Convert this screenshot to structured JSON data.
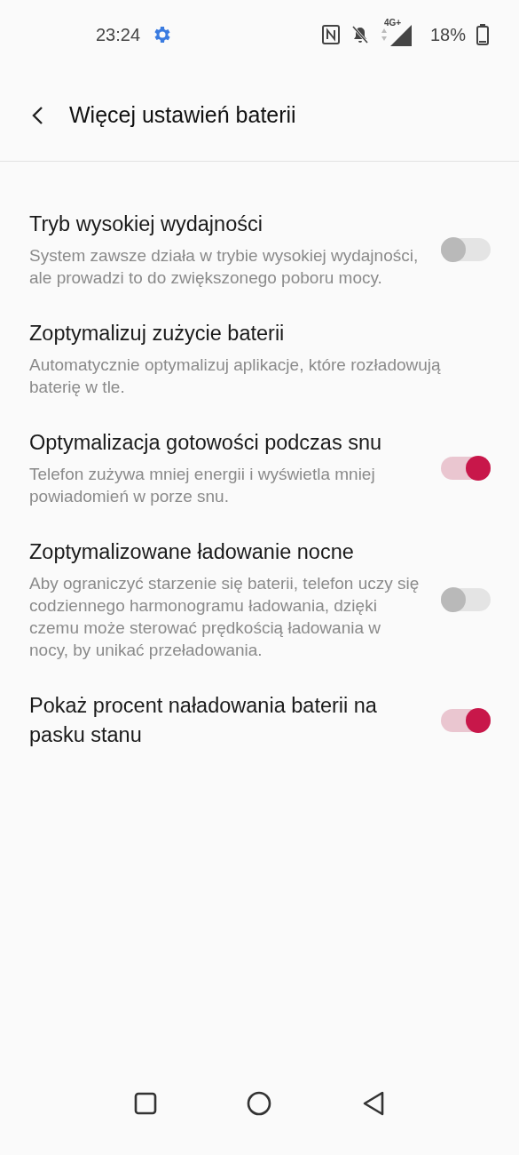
{
  "status_bar": {
    "time": "23:24",
    "network_type": "4G+",
    "battery": "18%"
  },
  "header": {
    "title": "Więcej ustawień baterii"
  },
  "settings": [
    {
      "title": "Tryb wysokiej wydajności",
      "description": "System zawsze działa w trybie wysokiej wydajności, ale prowadzi to do zwiększonego poboru mocy.",
      "kind": "toggle",
      "on": false
    },
    {
      "title": "Zoptymalizuj zużycie baterii",
      "description": "Automatycznie optymalizuj aplikacje, które rozładowują baterię w tle.",
      "kind": "link"
    },
    {
      "title": "Optymalizacja gotowości podczas snu",
      "description": "Telefon zużywa mniej energii i wyświetla mniej powiadomień w porze snu.",
      "kind": "toggle",
      "on": true
    },
    {
      "title": "Zoptymalizowane ładowanie nocne",
      "description": "Aby ograniczyć starzenie się baterii, telefon uczy się codziennego harmonogramu ładowania, dzięki czemu może sterować prędkością ładowania w nocy, by unikać przeładowania.",
      "kind": "toggle",
      "on": false
    },
    {
      "title": "Pokaż procent naładowania baterii na pasku stanu",
      "kind": "toggle",
      "on": true
    }
  ]
}
